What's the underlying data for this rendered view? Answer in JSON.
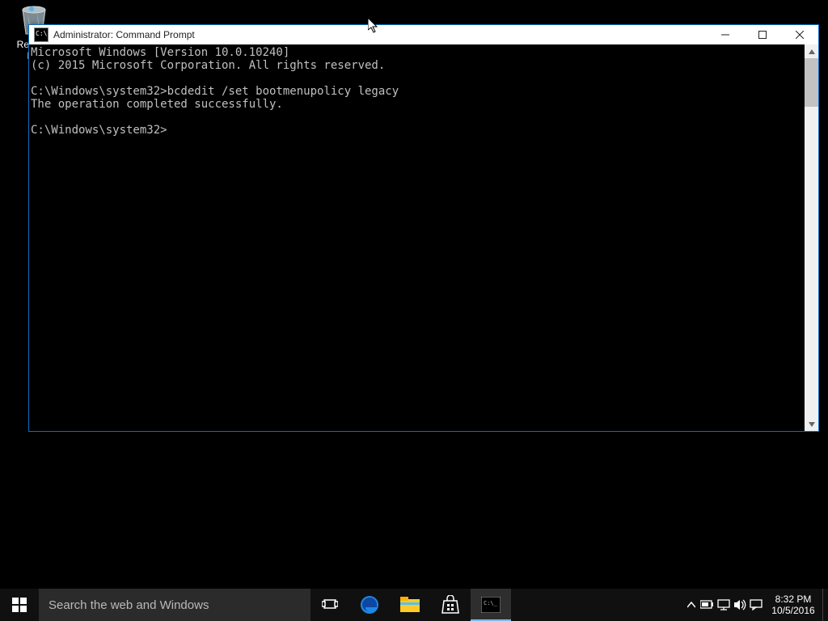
{
  "desktop": {
    "recycle_bin_label": "Recycle Bin"
  },
  "window": {
    "title": "Administrator: Command Prompt"
  },
  "console": {
    "line1": "Microsoft Windows [Version 10.0.10240]",
    "line2": "(c) 2015 Microsoft Corporation. All rights reserved.",
    "line3": "",
    "line4": "C:\\Windows\\system32>bcdedit /set bootmenupolicy legacy",
    "line5": "The operation completed successfully.",
    "line6": "",
    "line7": "C:\\Windows\\system32>"
  },
  "taskbar": {
    "search_placeholder": "Search the web and Windows",
    "time": "8:32 PM",
    "date": "10/5/2016"
  }
}
